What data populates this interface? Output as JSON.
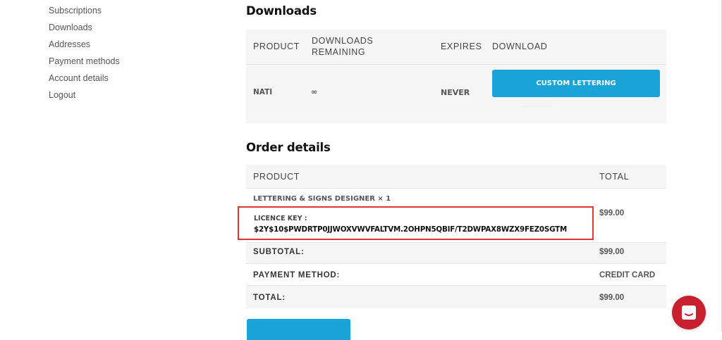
{
  "sidebar": {
    "items": [
      {
        "label": "Subscriptions"
      },
      {
        "label": "Downloads"
      },
      {
        "label": "Addresses"
      },
      {
        "label": "Payment methods"
      },
      {
        "label": "Account details"
      },
      {
        "label": "Logout"
      }
    ]
  },
  "downloads": {
    "title": "Downloads",
    "headers": {
      "product": "PRODUCT",
      "remaining_line1": "DOWNLOADS",
      "remaining_line2": "REMAINING",
      "expires": "EXPIRES",
      "download": "DOWNLOAD"
    },
    "row": {
      "product": "NATI",
      "remaining": "∞",
      "expires": "NEVER",
      "download_button": "CUSTOM LETTERING"
    }
  },
  "order": {
    "title": "Order details",
    "headers": {
      "product": "PRODUCT",
      "total": "TOTAL"
    },
    "item": {
      "name": "LETTERING & SIGNS DESIGNER × 1",
      "licence_label": "LICENCE KEY :",
      "licence_key": "$2Y$10$PWDRTP0JJWOXVWVFALTVM.2OHPN5QBIF/T2DWPAX8WZX9FEZ0SGTM",
      "total": "$99.00"
    },
    "subtotal": {
      "label": "SUBTOTAL:",
      "value": "$99.00"
    },
    "payment_method": {
      "label": "PAYMENT METHOD:",
      "value": "CREDIT CARD"
    },
    "total": {
      "label": "TOTAL:",
      "value": "$99.00"
    }
  },
  "chat": {
    "icon": "chat-icon",
    "color": "#c8202f"
  },
  "colors": {
    "accent": "#1aa3d6",
    "highlight": "#e0353b"
  }
}
